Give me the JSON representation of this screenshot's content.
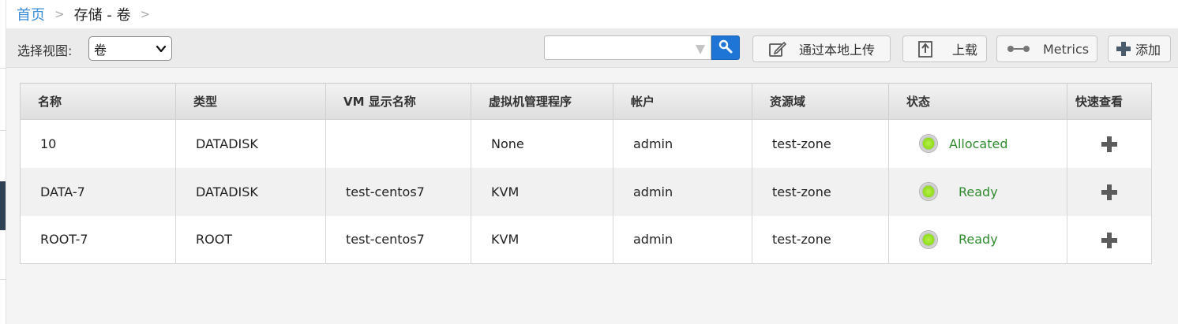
{
  "breadcrumb": {
    "home": "首页",
    "separator": ">",
    "current": "存储 - 卷",
    "trailing_separator": ">"
  },
  "toolbar": {
    "view_label": "选择视图:",
    "view_value": "卷",
    "search_placeholder": "",
    "upload_local_label": "通过本地上传",
    "upload_label": "上载",
    "metrics_label": "Metrics",
    "add_label": "添加"
  },
  "table": {
    "columns": [
      "名称",
      "类型",
      "VM 显示名称",
      "虚拟机管理程序",
      "帐户",
      "资源域",
      "状态",
      "快速查看"
    ],
    "rows": [
      {
        "name": "10",
        "type": "DATADISK",
        "vm_name": "",
        "hypervisor": "None",
        "account": "admin",
        "zone": "test-zone",
        "state": "Allocated"
      },
      {
        "name": "DATA-7",
        "type": "DATADISK",
        "vm_name": "test-centos7",
        "hypervisor": "KVM",
        "account": "admin",
        "zone": "test-zone",
        "state": "Ready"
      },
      {
        "name": "ROOT-7",
        "type": "ROOT",
        "vm_name": "test-centos7",
        "hypervisor": "KVM",
        "account": "admin",
        "zone": "test-zone",
        "state": "Ready"
      }
    ]
  },
  "colors": {
    "link": "#3d8ed8",
    "search_button": "#1f75d6",
    "state_text": "#2e8b2e",
    "state_dot": "#8fdc1c"
  },
  "icons": {
    "search": "magnifier-icon",
    "filter": "filter-triangle-icon",
    "upload_local": "edit-icon",
    "upload": "upload-icon",
    "metrics": "metrics-icon",
    "add": "plus-icon",
    "quickview": "plus-icon"
  }
}
